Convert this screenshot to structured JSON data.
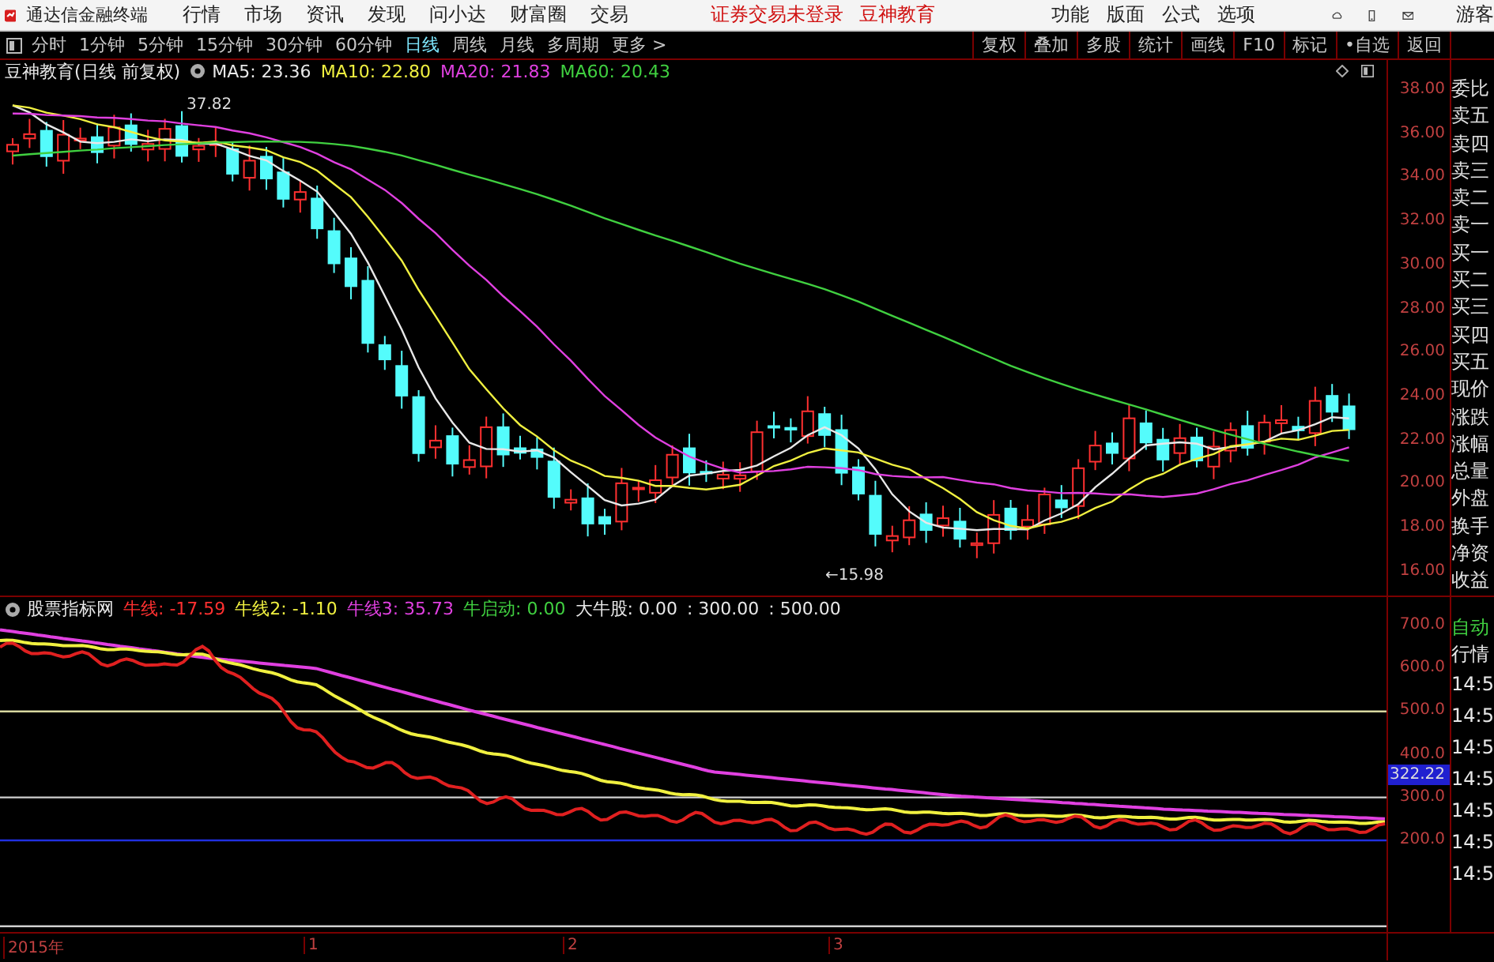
{
  "app_bar": {
    "app_name": "通达信金融终端",
    "menu": [
      "行情",
      "市场",
      "资讯",
      "发现",
      "问小达",
      "财富圈",
      "交易"
    ],
    "notices": [
      "证券交易未登录",
      "豆神教育"
    ],
    "tools": [
      "功能",
      "版面",
      "公式",
      "选项"
    ],
    "user": "游客"
  },
  "period_bar": {
    "periods": [
      {
        "label": "分时",
        "selected": false
      },
      {
        "label": "1分钟",
        "selected": false
      },
      {
        "label": "5分钟",
        "selected": false
      },
      {
        "label": "15分钟",
        "selected": false
      },
      {
        "label": "30分钟",
        "selected": false
      },
      {
        "label": "60分钟",
        "selected": false
      },
      {
        "label": "日线",
        "selected": true
      },
      {
        "label": "周线",
        "selected": false
      },
      {
        "label": "月线",
        "selected": false
      },
      {
        "label": "多周期",
        "selected": false
      },
      {
        "label": "更多 >",
        "selected": false
      }
    ],
    "actions": [
      "复权",
      "叠加",
      "多股",
      "统计",
      "画线",
      "F10",
      "标记",
      "•自选",
      "返回"
    ]
  },
  "main_chart": {
    "title": "豆神教育(日线 前复权)",
    "indicators": [
      {
        "label": "MA5: 23.36",
        "color": "#e8e8e8"
      },
      {
        "label": "MA10: 22.80",
        "color": "#f0f040"
      },
      {
        "label": "MA20: 21.83",
        "color": "#e040e0"
      },
      {
        "label": "MA60: 20.43",
        "color": "#40d040"
      }
    ],
    "high_mark": "37.82",
    "low_mark": "←15.98",
    "price_axis": [
      "38.00",
      "36.00",
      "34.00",
      "32.00",
      "30.00",
      "28.00",
      "26.00",
      "24.00",
      "22.00",
      "20.00",
      "18.00",
      "16.00"
    ]
  },
  "quote_labels": [
    "委比",
    "卖五",
    "卖四",
    "卖三",
    "卖二",
    "卖一",
    "买一",
    "买二",
    "买三",
    "买四",
    "买五",
    "现价",
    "涨跌",
    "涨幅",
    "总量",
    "外盘",
    "换手",
    "净资",
    "收益"
  ],
  "indicator_chart": {
    "title": "股票指标网",
    "values": [
      {
        "label": "牛线: -17.59",
        "color": "#ff3030"
      },
      {
        "label": "牛线2: -1.10",
        "color": "#f0f040"
      },
      {
        "label": "牛线3: 35.73",
        "color": "#e040e0"
      },
      {
        "label": "牛启动: 0.00",
        "color": "#40d040"
      },
      {
        "label": "大牛股: 0.00",
        "color": "#e8e8e8"
      },
      {
        "label": ": 300.00",
        "color": "#e8e8e8"
      },
      {
        "label": ": 500.00",
        "color": "#e8e8e8"
      }
    ],
    "value_axis": [
      "700.0",
      "600.0",
      "500.0",
      "400.0",
      "300.0",
      "200.0"
    ],
    "current_value": "322.22"
  },
  "side_panel": {
    "modes": [
      {
        "label": "自动",
        "color": "#40d040"
      },
      {
        "label": "行情",
        "color": "#e8e8e8"
      }
    ],
    "times": [
      "14:5",
      "14:5",
      "14:5",
      "14:5",
      "14:5",
      "14:5",
      "14:5"
    ]
  },
  "time_axis": [
    "2015年",
    "1",
    "2",
    "3"
  ]
}
